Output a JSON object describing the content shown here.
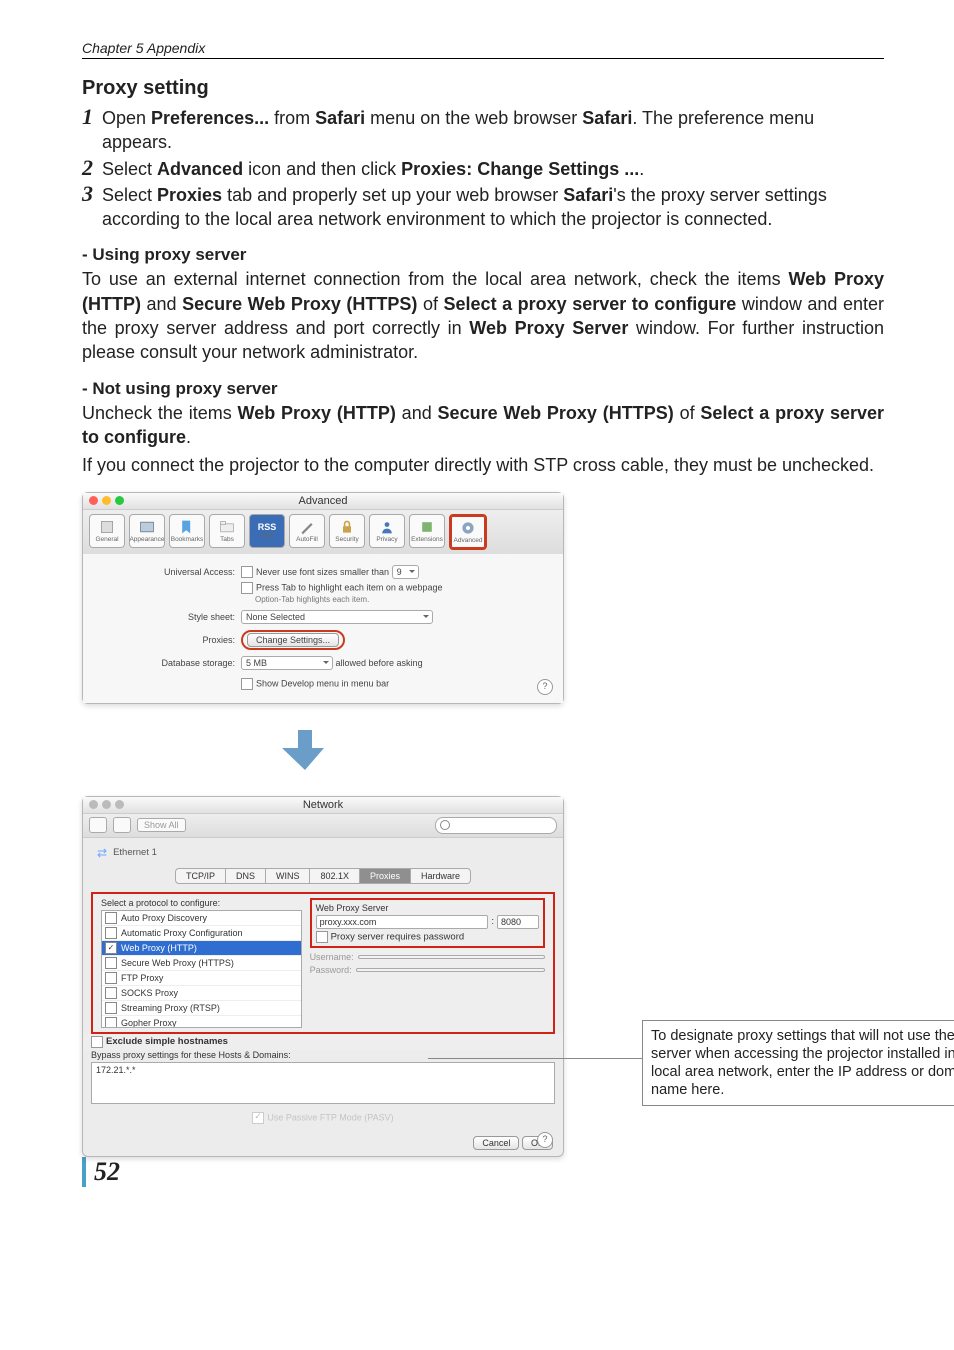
{
  "running_head": "Chapter 5 Appendix",
  "h2": "Proxy setting",
  "steps": [
    {
      "pre": "Open ",
      "b1": "Preferences...",
      "mid1": " from ",
      "b2": "Safari",
      "mid2": " menu on the web browser ",
      "b3": "Safari",
      "post": ". The preference menu appears."
    },
    {
      "pre": "Select ",
      "b1": "Advanced",
      "mid1": " icon and then click ",
      "b2": "Proxies: Change Settings ...",
      "post": "."
    },
    {
      "pre": "Select ",
      "b1": "Proxies",
      "mid1": " tab and properly set up your web browser ",
      "b2": "Safari",
      "post": "'s the proxy server settings according to the local area network environment to which the projector is connected."
    }
  ],
  "sub1_head": "- Using proxy server",
  "sub1_text_a": "To use an external internet connection from the local area network, check the items ",
  "sub1_b1": "Web Proxy (HTTP)",
  "sub1_mid1": " and ",
  "sub1_b2": "Secure Web Proxy (HTTPS)",
  "sub1_mid2": " of ",
  "sub1_b3": "Select a proxy server to configure",
  "sub1_mid3": " window and enter the proxy server address and port correctly in ",
  "sub1_b4": "Web Proxy Server",
  "sub1_post": " window. For further instruction please consult your network administrator.",
  "sub2_head": "- Not using proxy server",
  "sub2_text_a": "Uncheck the items ",
  "sub2_b1": "Web Proxy (HTTP)",
  "sub2_mid1": " and ",
  "sub2_b2": "Secure Web Proxy (HTTPS)",
  "sub2_mid2": " of ",
  "sub2_b3": "Select a proxy server to configure",
  "sub2_post": ".",
  "sub2_text_b": "If you connect the projector to the computer directly with STP cross cable, they must be unchecked.",
  "win1": {
    "title": "Advanced",
    "tabs": [
      "General",
      "Appearance",
      "Bookmarks",
      "Tabs",
      "RSS",
      "AutoFill",
      "Security",
      "Privacy",
      "Extensions",
      "Advanced"
    ],
    "ua_label": "Universal Access:",
    "ua_chk1": "Never use font sizes smaller than",
    "ua_size": "9",
    "ua_chk2": "Press Tab to highlight each item on a webpage",
    "ua_note": "Option-Tab highlights each item.",
    "ss_label": "Style sheet:",
    "ss_val": "None Selected",
    "px_label": "Proxies:",
    "px_btn": "Change Settings...",
    "db_label": "Database storage:",
    "db_val": "5 MB",
    "db_after": "allowed before asking",
    "dev_chk": "Show Develop menu in menu bar"
  },
  "win2": {
    "title": "Network",
    "showall": "Show All",
    "eth": "Ethernet 1",
    "tabs": [
      "TCP/IP",
      "DNS",
      "WINS",
      "802.1X",
      "Proxies",
      "Hardware"
    ],
    "proto_hdr": "Select a protocol to configure:",
    "protocols": [
      {
        "label": "Auto Proxy Discovery",
        "checked": false,
        "sel": false
      },
      {
        "label": "Automatic Proxy Configuration",
        "checked": false,
        "sel": false
      },
      {
        "label": "Web Proxy (HTTP)",
        "checked": true,
        "sel": true
      },
      {
        "label": "Secure Web Proxy (HTTPS)",
        "checked": false,
        "sel": false
      },
      {
        "label": "FTP Proxy",
        "checked": false,
        "sel": false
      },
      {
        "label": "SOCKS Proxy",
        "checked": false,
        "sel": false
      },
      {
        "label": "Streaming Proxy (RTSP)",
        "checked": false,
        "sel": false
      },
      {
        "label": "Gopher Proxy",
        "checked": false,
        "sel": false
      }
    ],
    "wps_hdr": "Web Proxy Server",
    "wps_host": "proxy.xxx.com",
    "wps_port": "8080",
    "wps_reqpwd": "Proxy server requires password",
    "user_lbl": "Username:",
    "pass_lbl": "Password:",
    "excl_label": "Exclude simple hostnames",
    "bypass_hdr": "Bypass proxy settings for these Hosts & Domains:",
    "bypass_val": "172.21.*.*",
    "pasv": "Use Passive FTP Mode (PASV)",
    "cancel": "Cancel",
    "ok": "OK"
  },
  "note": "To designate proxy settings that will not use the proxy server when accessing the projector installed in the local area network, enter the IP address or domain name here.",
  "page_num": "52"
}
